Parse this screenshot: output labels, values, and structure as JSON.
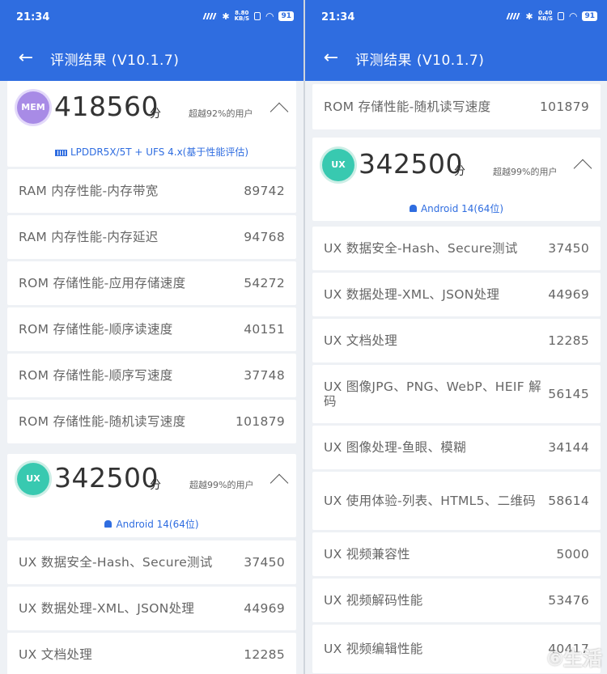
{
  "status": {
    "time": "21:34",
    "battery": "91"
  },
  "left": {
    "net_speed": "8.80\nKB/S",
    "title": "评测结果 (V10.1.7)",
    "mem": {
      "badge": "MEM",
      "score": "418560",
      "unit": "分",
      "surpass": "超越92%的用户",
      "info": "LPDDR5X/5T + UFS 4.x(基于性能评估)",
      "rows": [
        {
          "label": "RAM 内存性能-内存带宽",
          "value": "89742"
        },
        {
          "label": "RAM 内存性能-内存延迟",
          "value": "94768"
        },
        {
          "label": "ROM 存储性能-应用存储速度",
          "value": "54272"
        },
        {
          "label": "ROM 存储性能-顺序读速度",
          "value": "40151"
        },
        {
          "label": "ROM 存储性能-顺序写速度",
          "value": "37748"
        },
        {
          "label": "ROM 存储性能-随机读写速度",
          "value": "101879"
        }
      ]
    },
    "ux": {
      "badge": "UX",
      "score": "342500",
      "unit": "分",
      "surpass": "超越99%的用户",
      "info": "Android 14(64位)",
      "rows": [
        {
          "label": "UX 数据安全-Hash、Secure测试",
          "value": "37450"
        },
        {
          "label": "UX 数据处理-XML、JSON处理",
          "value": "44969"
        },
        {
          "label": "UX 文档处理",
          "value": "12285"
        }
      ]
    }
  },
  "right": {
    "net_speed": "0.40\nKB/S",
    "title": "评测结果 (V10.1.7)",
    "top_row": {
      "label": "ROM 存储性能-随机读写速度",
      "value": "101879"
    },
    "ux": {
      "badge": "UX",
      "score": "342500",
      "unit": "分",
      "surpass": "超越99%的用户",
      "info": "Android 14(64位)",
      "rows": [
        {
          "label": "UX 数据安全-Hash、Secure测试",
          "value": "37450"
        },
        {
          "label": "UX 数据处理-XML、JSON处理",
          "value": "44969"
        },
        {
          "label": "UX 文档处理",
          "value": "12285"
        },
        {
          "label": "UX 图像JPG、PNG、WebP、HEIF 解码",
          "value": "56145"
        },
        {
          "label": "UX 图像处理-鱼眼、模糊",
          "value": "34144"
        },
        {
          "label": "UX 使用体验-列表、HTML5、二维码",
          "value": "58614"
        },
        {
          "label": "UX 视频兼容性",
          "value": "5000"
        },
        {
          "label": "UX 视频解码性能",
          "value": "53476"
        },
        {
          "label": "UX 视频编辑性能",
          "value": "40417"
        }
      ]
    }
  },
  "watermark": "⑥生活"
}
